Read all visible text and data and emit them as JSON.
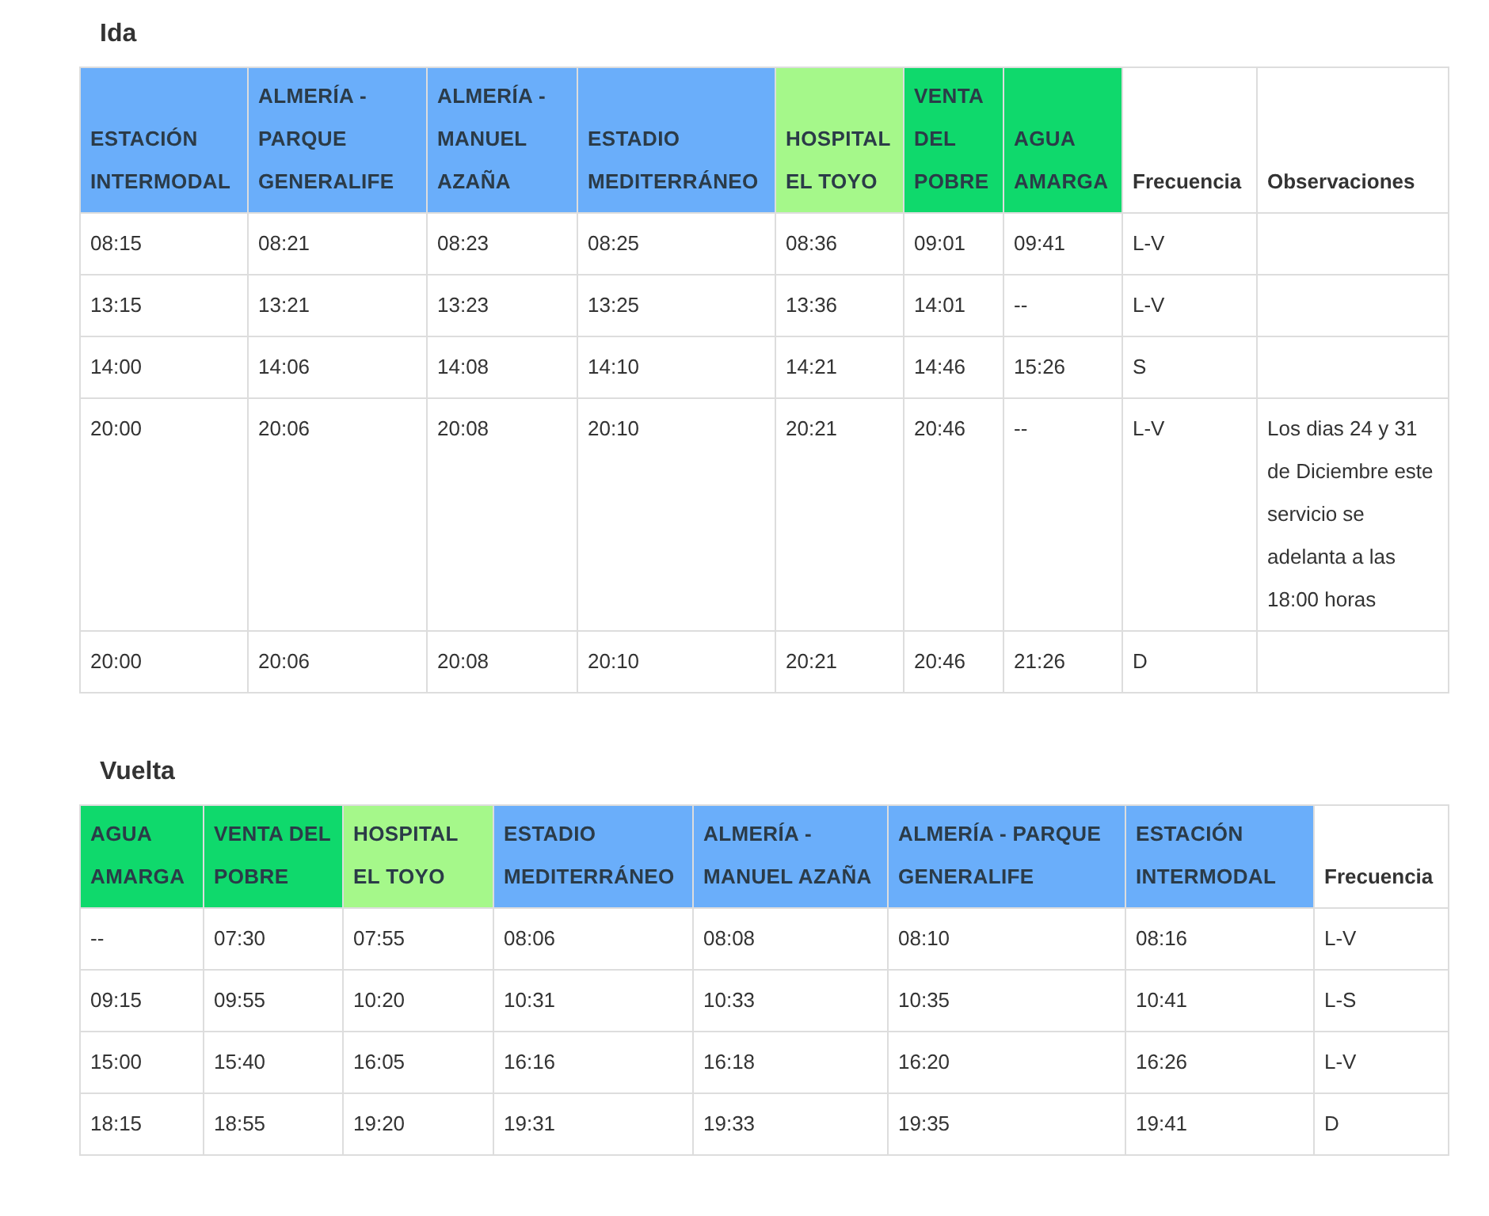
{
  "sections": [
    {
      "title": "Ida",
      "columns": [
        {
          "label": "ESTACIÓN INTERMODAL",
          "color": "#6aaefa"
        },
        {
          "label": "ALMERÍA - PARQUE GENERALIFE",
          "color": "#6aaefa"
        },
        {
          "label": "ALMERÍA - MANUEL AZAÑA",
          "color": "#6aaefa"
        },
        {
          "label": "ESTADIO MEDITERRÁNEO",
          "color": "#6aaefa"
        },
        {
          "label": "HOSPITAL EL TOYO",
          "color": "#a5f88a"
        },
        {
          "label": "VENTA DEL POBRE",
          "color": "#0fd96c"
        },
        {
          "label": "AGUA AMARGA",
          "color": "#0fd96c"
        },
        {
          "label": "Frecuencia"
        },
        {
          "label": "Observaciones"
        }
      ],
      "rows": [
        {
          "cells": [
            "08:15",
            "08:21",
            "08:23",
            "08:25",
            "08:36",
            "09:01",
            "09:41",
            "L-V"
          ]
        },
        {
          "cells": [
            "13:15",
            "13:21",
            "13:23",
            "13:25",
            "13:36",
            "14:01",
            "--",
            "L-V"
          ]
        },
        {
          "cells": [
            "14:00",
            "14:06",
            "14:08",
            "14:10",
            "14:21",
            "14:46",
            "15:26",
            "S"
          ]
        },
        {
          "cells": [
            "20:00",
            "20:06",
            "20:08",
            "20:10",
            "20:21",
            "20:46",
            "--",
            "L-V",
            "Los dias 24 y 31 de Diciembre este servicio se adelanta a las 18:00 horas"
          ]
        },
        {
          "cells": [
            "20:00",
            "20:06",
            "20:08",
            "20:10",
            "20:21",
            "20:46",
            "21:26",
            "D"
          ]
        }
      ]
    },
    {
      "title": "Vuelta",
      "columns": [
        {
          "label": "AGUA AMARGA",
          "color": "#0fd96c"
        },
        {
          "label": "VENTA DEL POBRE",
          "color": "#0fd96c"
        },
        {
          "label": "HOSPITAL EL TOYO",
          "color": "#a5f88a"
        },
        {
          "label": "ESTADIO MEDITERRÁNEO",
          "color": "#6aaefa"
        },
        {
          "label": "ALMERÍA - MANUEL AZAÑA",
          "color": "#6aaefa"
        },
        {
          "label": "ALMERÍA - PARQUE GENERALIFE",
          "color": "#6aaefa"
        },
        {
          "label": "ESTACIÓN INTERMODAL",
          "color": "#6aaefa"
        },
        {
          "label": "Frecuencia"
        }
      ],
      "rows": [
        {
          "cells": [
            "--",
            "07:30",
            "07:55",
            "08:06",
            "08:08",
            "08:10",
            "08:16",
            "L-V"
          ]
        },
        {
          "cells": [
            "09:15",
            "09:55",
            "10:20",
            "10:31",
            "10:33",
            "10:35",
            "10:41",
            "L-S"
          ]
        },
        {
          "cells": [
            "15:00",
            "15:40",
            "16:05",
            "16:16",
            "16:18",
            "16:20",
            "16:26",
            "L-V"
          ]
        },
        {
          "cells": [
            "18:15",
            "18:55",
            "19:20",
            "19:31",
            "19:33",
            "19:35",
            "19:41",
            "D"
          ]
        }
      ]
    }
  ]
}
